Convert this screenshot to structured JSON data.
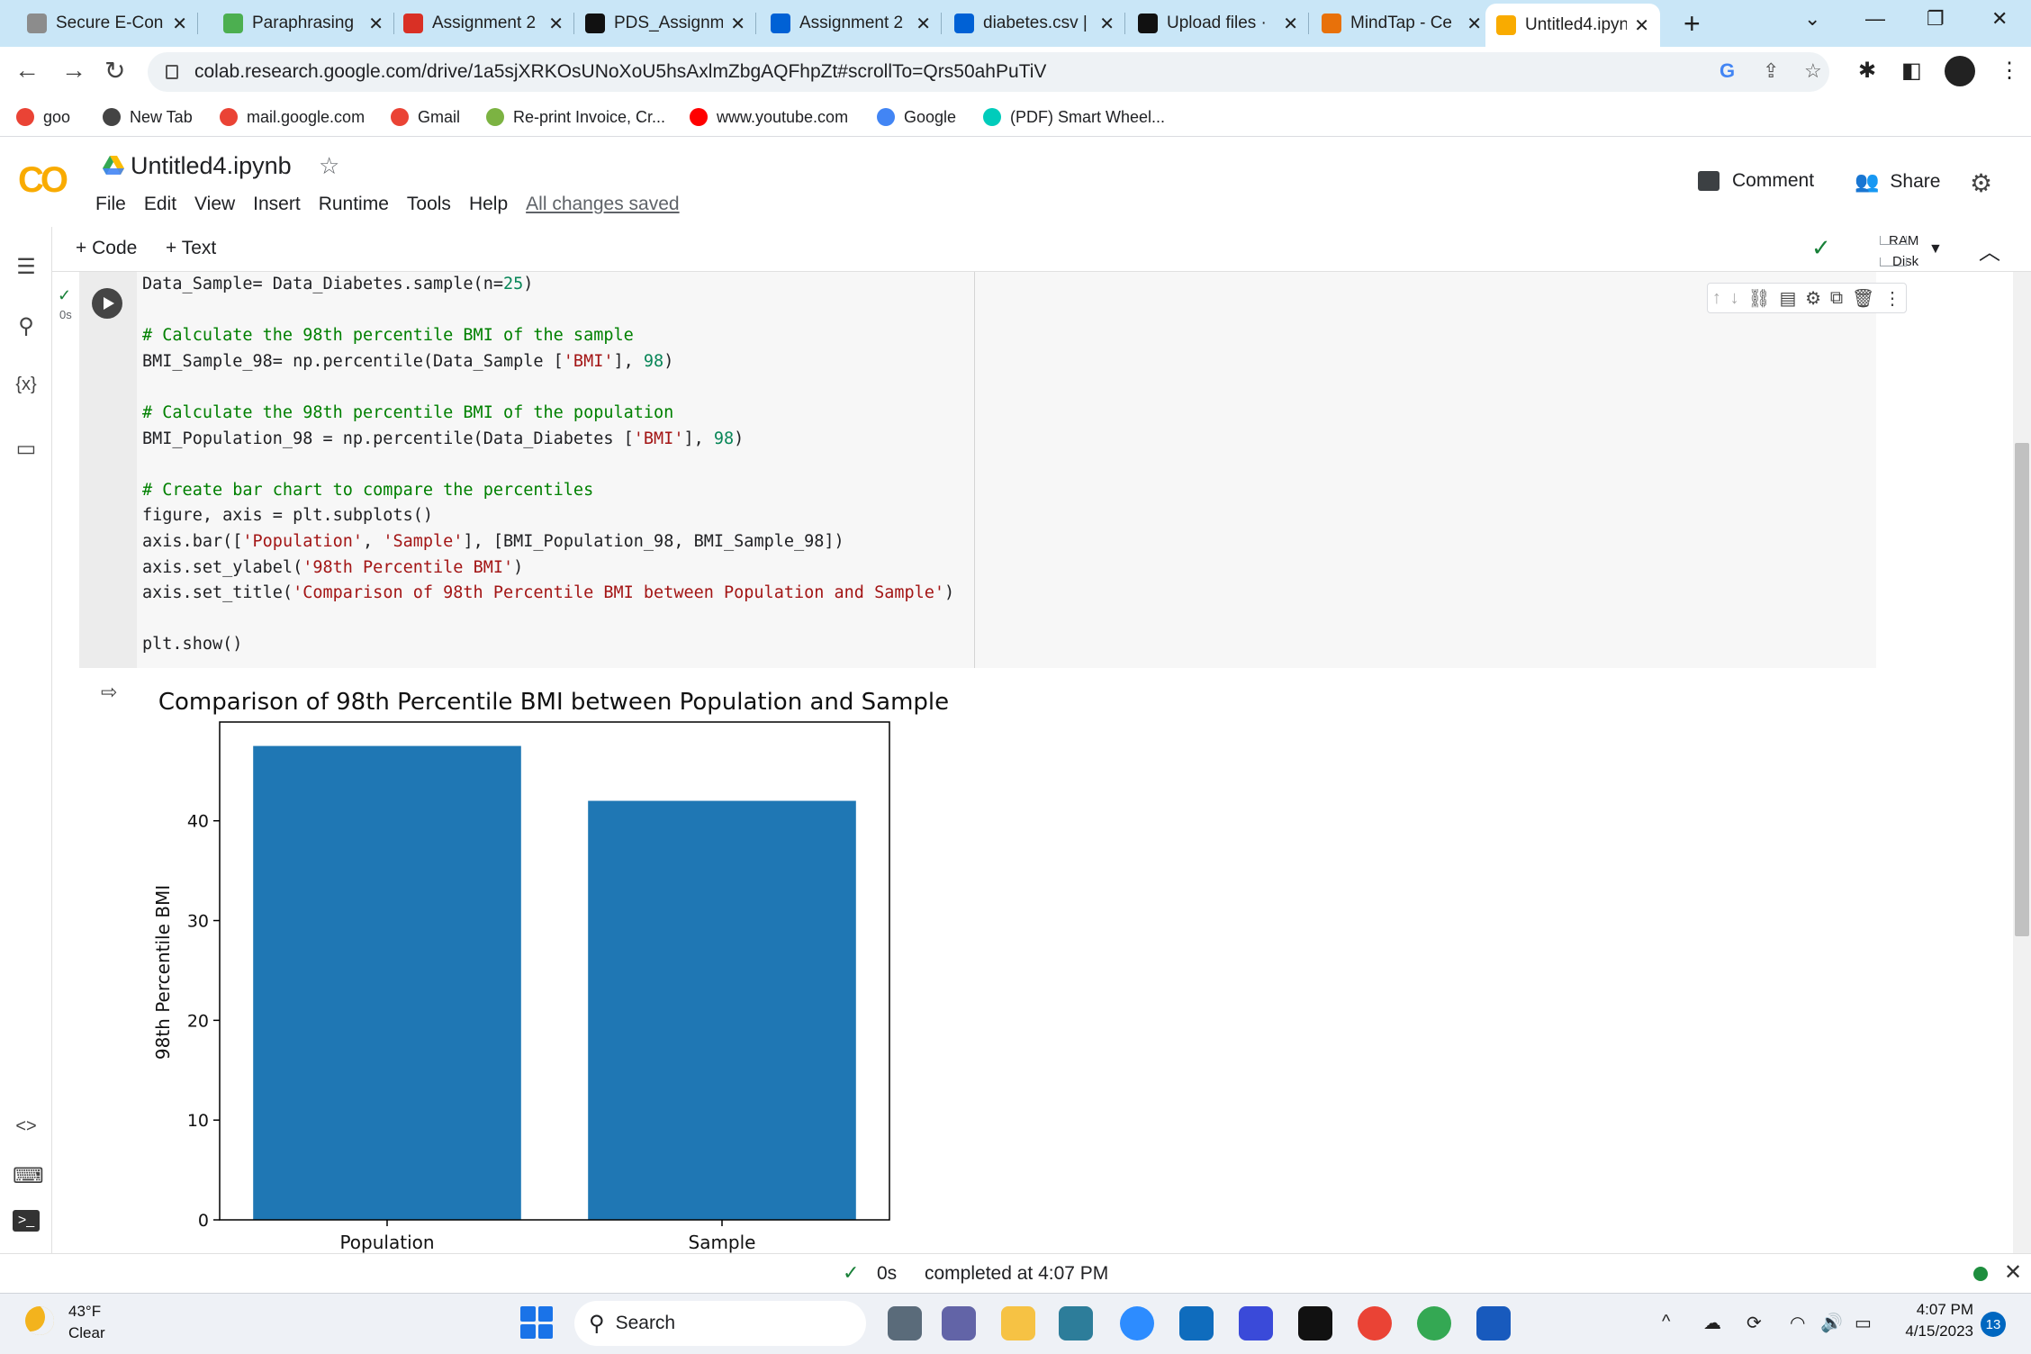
{
  "browser": {
    "tabs": [
      {
        "label": "Secure E-Con",
        "icon": "openai-icon",
        "color": "#8c8c8c"
      },
      {
        "label": "Paraphrasing",
        "icon": "quill-icon",
        "color": "#4caf50"
      },
      {
        "label": "Assignment 2",
        "icon": "lifebuoy-icon",
        "color": "#d93025"
      },
      {
        "label": "PDS_Assignm",
        "icon": "github-icon",
        "color": "#111111"
      },
      {
        "label": "Assignment 2",
        "icon": "box-icon",
        "color": "#0061d5"
      },
      {
        "label": "diabetes.csv |",
        "icon": "box-icon",
        "color": "#0061d5"
      },
      {
        "label": "Upload files ·",
        "icon": "github-icon",
        "color": "#111111"
      },
      {
        "label": "MindTap - Ce",
        "icon": "mindtap-icon",
        "color": "#e8710a"
      },
      {
        "label": "Untitled4.ipyn",
        "icon": "colab-icon",
        "color": "#f9ab00"
      }
    ],
    "address": "colab.research.google.com/drive/1a5sjXRKOsUNoXoU5hsAxlmZbgAQFhpZt#scrollTo=Qrs50ahPuTiV",
    "bookmarks": [
      {
        "label": "goo",
        "icon": "gmail-icon",
        "color": "#ea4335"
      },
      {
        "label": "New Tab",
        "icon": "globe-icon",
        "color": "#444444"
      },
      {
        "label": "mail.google.com",
        "icon": "gmail-icon",
        "color": "#ea4335"
      },
      {
        "label": "Gmail",
        "icon": "gmail-icon",
        "color": "#ea4335"
      },
      {
        "label": "Re-print Invoice, Cr...",
        "icon": "invoice-icon",
        "color": "#7cb342"
      },
      {
        "label": "www.youtube.com",
        "icon": "youtube-icon",
        "color": "#ff0000"
      },
      {
        "label": "Google",
        "icon": "google-icon",
        "color": "#4285f4"
      },
      {
        "label": "(PDF) Smart Wheel...",
        "icon": "researchgate-icon",
        "color": "#00ccbb"
      }
    ]
  },
  "colab": {
    "title": "Untitled4.ipynb",
    "menu": [
      "File",
      "Edit",
      "View",
      "Insert",
      "Runtime",
      "Tools",
      "Help"
    ],
    "save_status": "All changes saved",
    "comment_label": "Comment",
    "share_label": "Share",
    "add_code_label": "+ Code",
    "add_text_label": "+ Text",
    "ram_label": "RAM",
    "disk_label": "Disk",
    "exec_time": "0s"
  },
  "cell_code": [
    [
      {
        "t": "Data_Sample= Data_Diabetes.sample(n=",
        "c": ""
      },
      {
        "t": "25",
        "c": "num"
      },
      {
        "t": ")",
        "c": ""
      }
    ],
    [],
    [
      {
        "t": "# Calculate the 98th percentile BMI of the sample",
        "c": "com"
      }
    ],
    [
      {
        "t": "BMI_Sample_98= np.percentile(Data_Sample [",
        "c": ""
      },
      {
        "t": "'BMI'",
        "c": "str"
      },
      {
        "t": "], ",
        "c": ""
      },
      {
        "t": "98",
        "c": "num"
      },
      {
        "t": ")",
        "c": ""
      }
    ],
    [],
    [
      {
        "t": "# Calculate the 98th percentile BMI of the population",
        "c": "com"
      }
    ],
    [
      {
        "t": "BMI_Population_98 = np.percentile(Data_Diabetes [",
        "c": ""
      },
      {
        "t": "'BMI'",
        "c": "str"
      },
      {
        "t": "], ",
        "c": ""
      },
      {
        "t": "98",
        "c": "num"
      },
      {
        "t": ")",
        "c": ""
      }
    ],
    [],
    [
      {
        "t": "# Create bar chart to compare the percentiles",
        "c": "com"
      }
    ],
    [
      {
        "t": "figure, axis = plt.subplots()",
        "c": ""
      }
    ],
    [
      {
        "t": "axis.bar([",
        "c": ""
      },
      {
        "t": "'Population'",
        "c": "str"
      },
      {
        "t": ", ",
        "c": ""
      },
      {
        "t": "'Sample'",
        "c": "str"
      },
      {
        "t": "], [BMI_Population_98, BMI_Sample_98])",
        "c": ""
      }
    ],
    [
      {
        "t": "axis.set_ylabel(",
        "c": ""
      },
      {
        "t": "'98th Percentile BMI'",
        "c": "str"
      },
      {
        "t": ")",
        "c": ""
      }
    ],
    [
      {
        "t": "axis.set_title(",
        "c": ""
      },
      {
        "t": "'Comparison of 98th Percentile BMI between Population and Sample'",
        "c": "str"
      },
      {
        "t": ")",
        "c": ""
      }
    ],
    [],
    [
      {
        "t": "plt.show()",
        "c": ""
      }
    ]
  ],
  "chart_data": {
    "type": "bar",
    "title": "Comparison of 98th Percentile BMI between Population and Sample",
    "xlabel": "",
    "ylabel": "98th Percentile BMI",
    "categories": [
      "Population",
      "Sample"
    ],
    "values": [
      47.5,
      42.0
    ],
    "ylim": [
      0,
      49.9
    ],
    "yticks": [
      0,
      10,
      20,
      30,
      40
    ],
    "bar_color": "#1f77b4",
    "grid": false
  },
  "status": {
    "exec_time": "0s",
    "message": "completed at 4:07 PM"
  },
  "taskbar": {
    "temperature": "43°F",
    "condition": "Clear",
    "search_label": "Search",
    "time": "4:07 PM",
    "date": "4/15/2023",
    "notifications": "13"
  }
}
